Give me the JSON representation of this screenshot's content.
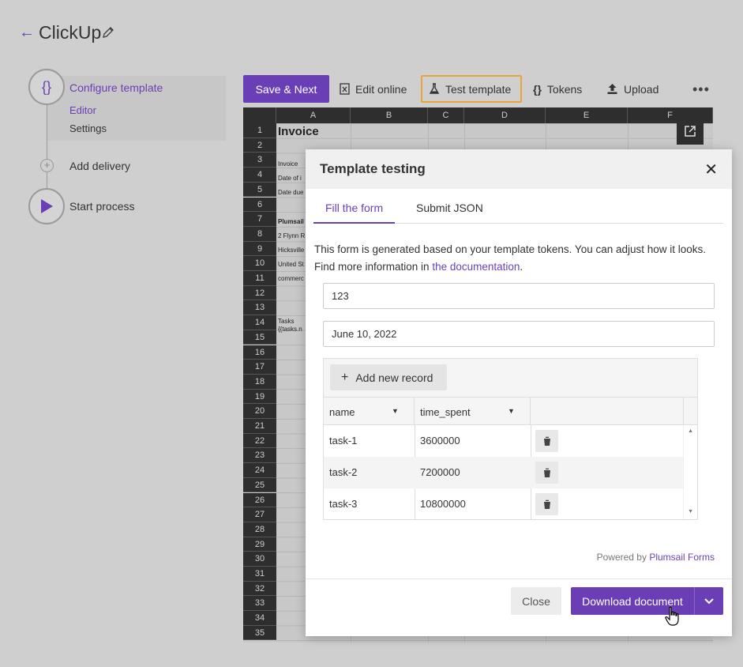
{
  "header": {
    "title": "ClickUp"
  },
  "steps": {
    "configure": {
      "label": "Configure template",
      "icon": "{}"
    },
    "sub_items": [
      "Editor",
      "Settings"
    ],
    "add_delivery": "Add delivery",
    "start_process": "Start process"
  },
  "toolbar": {
    "save_next": "Save & Next",
    "edit_online": "Edit online",
    "test_template": "Test template",
    "tokens": "Tokens",
    "upload": "Upload",
    "more": "•••"
  },
  "sheet": {
    "columns": [
      "A",
      "B",
      "C",
      "D",
      "E",
      "F"
    ],
    "rows": [
      "1",
      "2",
      "3",
      "4",
      "5",
      "6",
      "7",
      "8",
      "9",
      "10",
      "11",
      "12",
      "13",
      "14",
      "15",
      "16",
      "17",
      "18",
      "19",
      "20",
      "21",
      "22",
      "23",
      "24",
      "25",
      "26",
      "27",
      "28",
      "29",
      "30",
      "31",
      "32",
      "33",
      "34",
      "35"
    ],
    "title_cell": "Invoice",
    "cells": [
      "Invoice",
      "Date of i",
      "Date due",
      "Plumsail",
      "2 Flynn R",
      "Hicksville",
      "United St",
      "commerc",
      "Tasks",
      "{{tasks.n"
    ]
  },
  "modal": {
    "title": "Template testing",
    "close_icon": "✕",
    "tabs": [
      "Fill the form",
      "Submit JSON"
    ],
    "description_prefix": "This form is generated based on your template tokens. You can adjust how it looks. Find more information in ",
    "description_link": "the documentation",
    "description_suffix": ".",
    "field1_value": "123",
    "field2_value": "June 10, 2022",
    "add_record": "Add new record",
    "columns": [
      "name",
      "time_spent"
    ],
    "rows": [
      {
        "name": "task-1",
        "time_spent": "3600000"
      },
      {
        "name": "task-2",
        "time_spent": "7200000"
      },
      {
        "name": "task-3",
        "time_spent": "10800000"
      }
    ],
    "powered_prefix": "Powered by ",
    "powered_link": "Plumsail Forms",
    "close_button": "Close",
    "download_button": "Download document"
  },
  "colors": {
    "accent": "#6a3fb5",
    "highlight": "#e9a33a"
  }
}
